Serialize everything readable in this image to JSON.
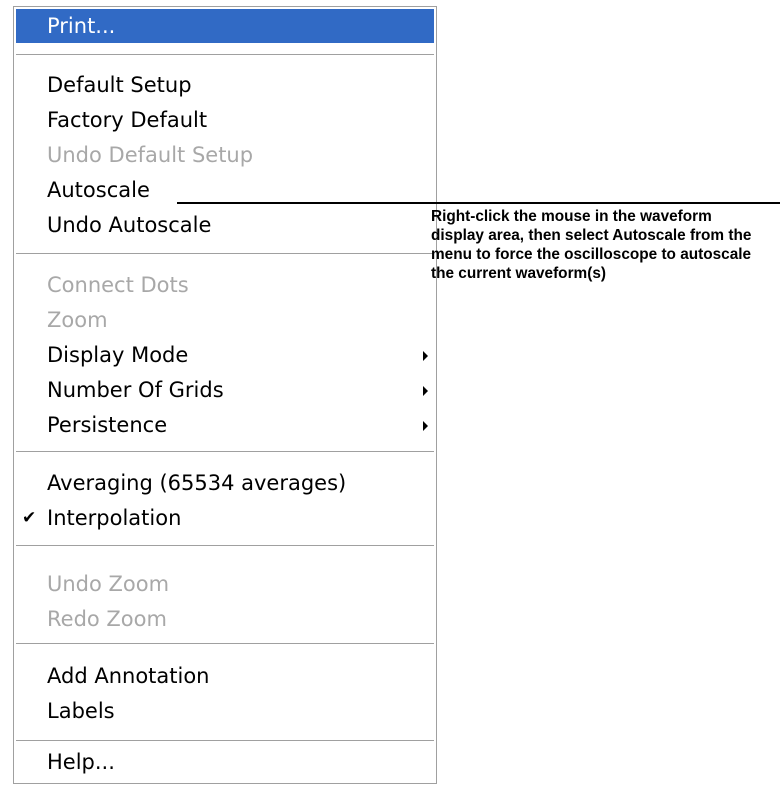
{
  "menu": {
    "print": "Print...",
    "default_setup": "Default Setup",
    "factory_default": "Factory Default",
    "undo_default_setup": "Undo Default Setup",
    "autoscale": "Autoscale",
    "undo_autoscale": "Undo Autoscale",
    "connect_dots": "Connect Dots",
    "zoom": "Zoom",
    "display_mode": "Display Mode",
    "number_of_grids": "Number Of Grids",
    "persistence": "Persistence",
    "averaging": "Averaging (65534 averages)",
    "interpolation": "Interpolation",
    "interpolation_checked": true,
    "undo_zoom": "Undo Zoom",
    "redo_zoom": "Redo Zoom",
    "add_annotation": "Add Annotation",
    "labels": "Labels",
    "help": "Help..."
  },
  "callout": {
    "text": "Right-click the mouse in the waveform display area, then select Autoscale from the menu to force the oscilloscope to autoscale the current waveform(s)"
  },
  "colors": {
    "highlight": "#316ac5",
    "disabled_text": "#a8a8a8"
  }
}
